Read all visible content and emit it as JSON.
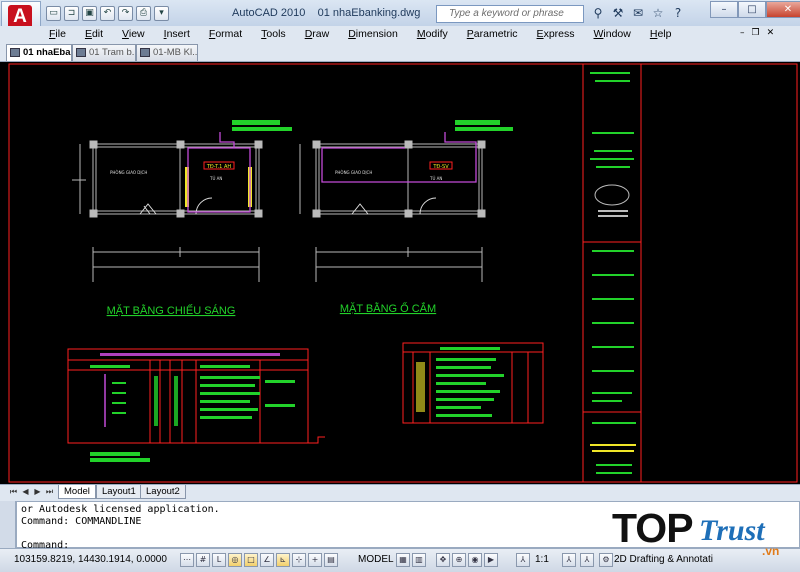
{
  "window": {
    "title": "AutoCAD 2010    01 nhaEbanking.dwg"
  },
  "app_button": {
    "icon": "autocad-logo-icon",
    "letter": "A"
  },
  "quick_access": [
    "new-icon",
    "open-icon",
    "save-icon",
    "undo-icon",
    "redo-icon",
    "plot-icon",
    "dropdown-icon"
  ],
  "search": {
    "placeholder": "Type a keyword or phrase"
  },
  "menus": [
    "File",
    "Edit",
    "View",
    "Insert",
    "Format",
    "Tools",
    "Draw",
    "Dimension",
    "Modify",
    "Parametric",
    "Express",
    "Window",
    "Help"
  ],
  "doc_tabs": [
    {
      "label": "01 nhaEba...",
      "active": true
    },
    {
      "label": "01 Tram b...",
      "active": false
    },
    {
      "label": "01-MB Kl...",
      "active": false
    }
  ],
  "drawing": {
    "label_lighting": "MẶT BẰNG CHIẾU SÁNG",
    "label_outlets": "MẶT BẰNG Ổ CẮM",
    "panel_tag_1": "TĐ-T.1 AH",
    "panel_tag_2": "TĐ-SV",
    "right_note_1": "MẶT BẰNG CHIẾU SÁNG VÀ Ổ CẮM ĐIỆN"
  },
  "layout_tabs": [
    {
      "label": "Model",
      "active": true
    },
    {
      "label": "Layout1",
      "active": false
    },
    {
      "label": "Layout2",
      "active": false
    }
  ],
  "command_lines": [
    "or Autodesk licensed application.",
    "Command: COMMANDLINE",
    "",
    "Command:"
  ],
  "status": {
    "coords": "103159.8219, 14430.1914, 0.0000",
    "model": "MODEL",
    "scale": "1:1",
    "workspace": "2D Drafting & Annotati"
  },
  "watermark": {
    "top": "TOP",
    "trust": "Trust",
    "vn": ".vn"
  },
  "colors": {
    "canvas": "#000000",
    "lines": "#ff2020",
    "walls": "#b8b8b8",
    "accent": "#22d22a",
    "magenta": "#c24bd8",
    "yellow": "#f0e628"
  }
}
